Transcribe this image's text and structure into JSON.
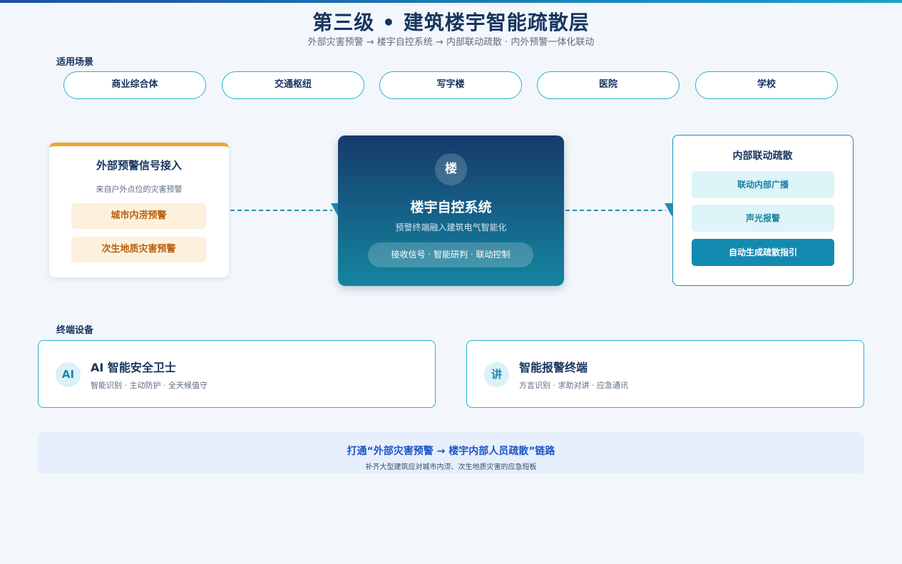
{
  "header": {
    "title": "第三级 • 建筑楼宇智能疏散层",
    "subtitle": "外部灾害预警 → 楼宇自控系统 → 内部联动疏散 · 内外预警一体化联动"
  },
  "scenes": {
    "label": "适用场景",
    "items": [
      "商业综合体",
      "交通枢纽",
      "写字楼",
      "医院",
      "学校"
    ]
  },
  "external": {
    "title": "外部预警信号接入",
    "desc": "来自户外点位的灾害预警",
    "items": [
      "城市内涝预警",
      "次生地质灾害预警"
    ]
  },
  "center": {
    "badge": "楼",
    "title": "楼宇自控系统",
    "desc": "预警终端融入建筑电气智能化",
    "pill": "接收信号 · 智能研判 · 联动控制"
  },
  "internal": {
    "title": "内部联动疏散",
    "items": [
      "联动内部广播",
      "声光报警",
      "自动生成疏散指引"
    ]
  },
  "devices": {
    "label": "终端设备",
    "items": [
      {
        "icon": "AI",
        "title": "AI 智能安全卫士",
        "desc": "智能识别 · 主动防护 · 全天候值守"
      },
      {
        "icon": "讲",
        "title": "智能报警终端",
        "desc": "方言识别 · 求助对讲 · 应急通讯"
      }
    ]
  },
  "footer": {
    "title": "打通“外部灾害预警 → 楼宇内部人员疏散”链路",
    "desc": "补齐大型建筑应对城市内涝、次生地质灾害的应急短板"
  },
  "colors": {
    "navy": "#17345f",
    "teal": "#148ab0",
    "orange": "#f0a52a",
    "warn_text": "#b85e0e",
    "link_blue": "#1a56c6"
  }
}
